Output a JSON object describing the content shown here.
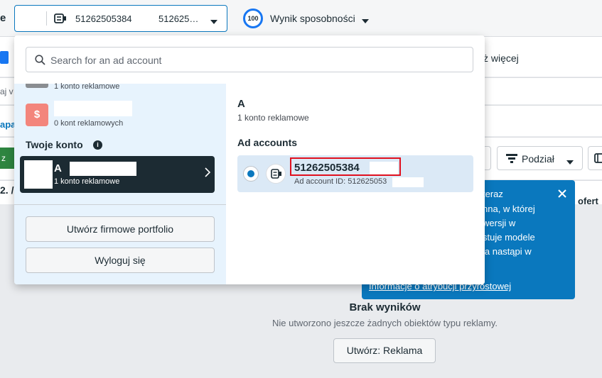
{
  "topbar": {
    "left_letter": "e",
    "account_id": "51262505384",
    "account_id_truncated": "512625…",
    "score_value": "100",
    "score_label": "Wynik sposobności"
  },
  "background": {
    "more_label": "ż więcej",
    "left_fragment_1": "aj v",
    "left_fragment_2": "apa",
    "left_fragment_3": "z",
    "left_fragment_4": "2. /",
    "breakdown_label": "Podział",
    "tooltip": {
      "lines": [
        "teraz",
        "nna, w której",
        "wersji w",
        "stuje modele",
        "ja nastąpi w"
      ],
      "link": "Informacje o atrybucji przyrostowej"
    },
    "right_fragment": "ofert",
    "empty_title": "Brak wyników",
    "empty_subtitle": "Nie utworzono jeszcze żadnych obiektów typu reklamy.",
    "create_button": "Utwórz: Reklama"
  },
  "dropdown": {
    "search_placeholder": "Search for an ad account",
    "left": {
      "partial_count": "1 konto reklamowe",
      "portfolio_avatar": "$",
      "portfolio_count": "0 kont reklamowych",
      "your_account_heading": "Twoje konto",
      "selected_name": "A",
      "selected_count": "1 konto reklamowe",
      "create_portfolio": "Utwórz firmowe portfolio",
      "logout": "Wyloguj się"
    },
    "right": {
      "portfolio_letter": "A",
      "portfolio_count": "1 konto reklamowe",
      "ad_accounts_heading": "Ad accounts",
      "account_id": "51262505384",
      "account_sub": "Ad account ID: 512625053"
    }
  }
}
